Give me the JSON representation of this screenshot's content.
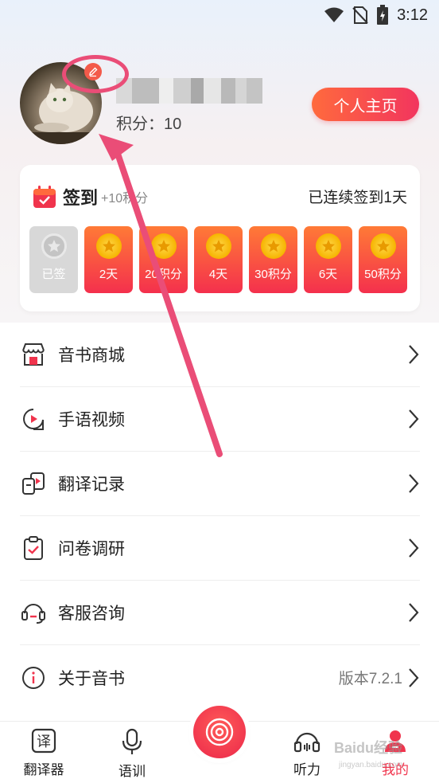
{
  "status_bar": {
    "time": "3:12",
    "icons": [
      "wifi-icon",
      "no-sim-icon",
      "battery-charging-icon"
    ]
  },
  "profile": {
    "points_text": "积分：10",
    "homepage_button": "个人主页"
  },
  "signin": {
    "title": "签到",
    "bonus": "+10积分",
    "streak_text": "已连续签到1天",
    "days": [
      {
        "label": "已签",
        "done": true
      },
      {
        "label": "2天",
        "done": false
      },
      {
        "label": "20积分",
        "done": false
      },
      {
        "label": "4天",
        "done": false
      },
      {
        "label": "30积分",
        "done": false
      },
      {
        "label": "6天",
        "done": false
      },
      {
        "label": "50积分",
        "done": false
      }
    ]
  },
  "menu": [
    {
      "label": "音书商城",
      "icon": "store-icon"
    },
    {
      "label": "手语视频",
      "icon": "video-play-icon"
    },
    {
      "label": "翻译记录",
      "icon": "translate-record-icon"
    },
    {
      "label": "问卷调研",
      "icon": "clipboard-check-icon"
    },
    {
      "label": "客服咨询",
      "icon": "headset-icon"
    },
    {
      "label": "关于音书",
      "icon": "info-icon",
      "version": "版本7.2.1"
    }
  ],
  "bottom_nav": {
    "items": [
      {
        "label": "翻译器",
        "icon": "translate-icon"
      },
      {
        "label": "语训",
        "icon": "microphone-icon"
      },
      {
        "label": "听力",
        "icon": "headphones-icon"
      },
      {
        "label": "我的",
        "icon": "user-icon",
        "active": true
      }
    ]
  },
  "watermark": {
    "text": "Baidu经验",
    "sub": "jingyan.baidu.com"
  },
  "colors": {
    "accent": "#f0344d",
    "orange": "#ff6a3d",
    "annotation": "#ea4d77"
  }
}
